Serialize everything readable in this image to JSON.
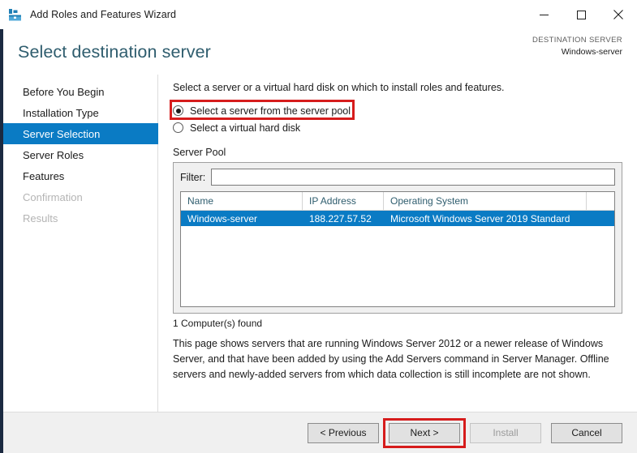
{
  "window": {
    "title": "Add Roles and Features Wizard",
    "app_icon": "server-manager-toolbox-icon",
    "controls": {
      "minimize": "minimize-icon",
      "maximize": "maximize-icon",
      "close": "close-icon"
    }
  },
  "header": {
    "page_title": "Select destination server",
    "destination_label": "DESTINATION SERVER",
    "destination_value": "Windows-server"
  },
  "nav": {
    "items": [
      {
        "label": "Before You Begin",
        "state": "normal"
      },
      {
        "label": "Installation Type",
        "state": "normal"
      },
      {
        "label": "Server Selection",
        "state": "selected"
      },
      {
        "label": "Server Roles",
        "state": "normal"
      },
      {
        "label": "Features",
        "state": "normal"
      },
      {
        "label": "Confirmation",
        "state": "disabled"
      },
      {
        "label": "Results",
        "state": "disabled"
      }
    ]
  },
  "content": {
    "intro": "Select a server or a virtual hard disk on which to install roles and features.",
    "radios": [
      {
        "label": "Select a server from the server pool",
        "checked": true
      },
      {
        "label": "Select a virtual hard disk",
        "checked": false
      }
    ],
    "server_pool_label": "Server Pool",
    "filter_label": "Filter:",
    "filter_value": "",
    "filter_placeholder": "",
    "grid": {
      "columns": [
        "Name",
        "IP Address",
        "Operating System"
      ],
      "rows": [
        {
          "name": "Windows-server",
          "ip": "188.227.57.52",
          "os": "Microsoft Windows Server 2019 Standard",
          "selected": true
        }
      ]
    },
    "found_text": "1 Computer(s) found",
    "note": "This page shows servers that are running Windows Server 2012 or a newer release of Windows Server, and that have been added by using the Add Servers command in Server Manager. Offline servers and newly-added servers from which data collection is still incomplete are not shown."
  },
  "footer": {
    "previous": "< Previous",
    "next": "Next >",
    "install": "Install",
    "cancel": "Cancel"
  },
  "annotations": {
    "highlight_color": "#d61c1c",
    "targets": [
      "select-server-from-pool-radio",
      "next-button"
    ]
  },
  "colors": {
    "accent_blue": "#0a7bc4",
    "title_teal": "#2f5d6e",
    "left_stripe": "#1b2a41",
    "footer_bg": "#f0f0f0"
  }
}
